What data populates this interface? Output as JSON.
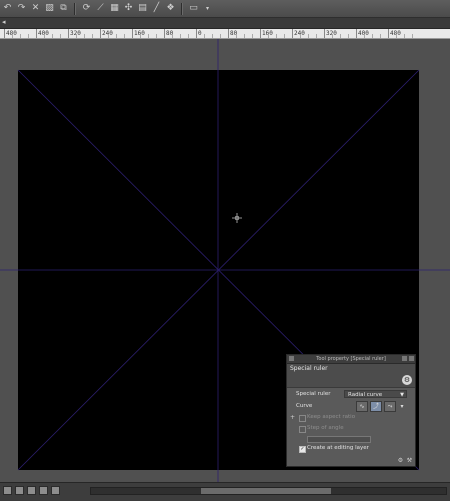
{
  "toolbar": {
    "icons": [
      "undo-icon",
      "redo-icon",
      "clear-icon",
      "fill-icon",
      "transform-icon",
      "rotate-icon",
      "snap-ruler-icon",
      "snap-grid-icon",
      "snap-special-ruler-icon",
      "ruler-icon",
      "line-icon",
      "curve-icon",
      "window-icon"
    ]
  },
  "ruler": {
    "labels": [
      "480",
      "400",
      "320",
      "240",
      "160",
      "80",
      "0",
      "80",
      "160",
      "240",
      "320",
      "400",
      "480"
    ]
  },
  "canvas": {
    "background": "#000000",
    "guide_color": "#2c1f6f",
    "workspace_color": "#505050"
  },
  "tool_property": {
    "title": "Tool property [Special ruler]",
    "subtitle": "Special ruler",
    "special_ruler_label": "Special ruler",
    "special_ruler_value": "Radial curve",
    "curve_label": "Curve",
    "keep_aspect_ratio": "Keep aspect ratio",
    "step_of_angle": "Step of angle",
    "create_at_editing_layer": "Create at editing layer",
    "create_checked": true
  }
}
